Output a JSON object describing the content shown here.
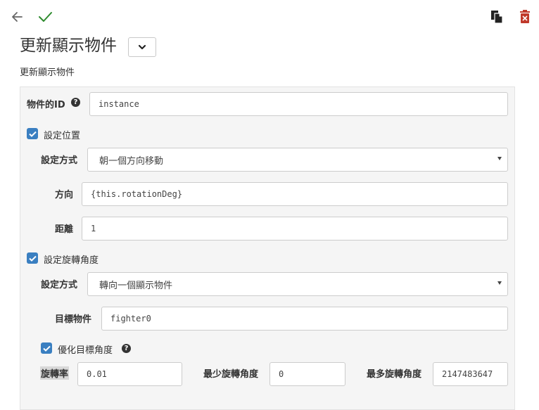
{
  "toolbar": {
    "back_icon": "arrow-left-icon",
    "confirm_icon": "check-icon",
    "copy_icon": "copy-icon",
    "delete_icon": "trash-icon",
    "confirm_color": "#2e8b2e",
    "delete_color": "#c0392b"
  },
  "header": {
    "title": "更新顯示物件",
    "subtitle": "更新顯示物件"
  },
  "form": {
    "object_id": {
      "label": "物件的ID",
      "value": "instance"
    },
    "set_position": {
      "label": "設定位置",
      "checked": true,
      "method": {
        "label": "設定方式",
        "value": "朝一個方向移動"
      },
      "direction": {
        "label": "方向",
        "value": "{this.rotationDeg}"
      },
      "distance": {
        "label": "距離",
        "value": "1"
      }
    },
    "set_rotation": {
      "label": "設定旋轉角度",
      "checked": true,
      "method": {
        "label": "設定方式",
        "value": "轉向一個顯示物件"
      },
      "target": {
        "label": "目標物件",
        "value": "fighter0"
      },
      "optimize": {
        "label": "優化目標角度",
        "checked": true,
        "rate": {
          "label": "旋轉率",
          "value": "0.01"
        },
        "min": {
          "label": "最少旋轉角度",
          "value": "0"
        },
        "max": {
          "label": "最多旋轉角度",
          "value": "2147483647"
        }
      }
    }
  },
  "colors": {
    "accent": "#3a7fc1"
  }
}
